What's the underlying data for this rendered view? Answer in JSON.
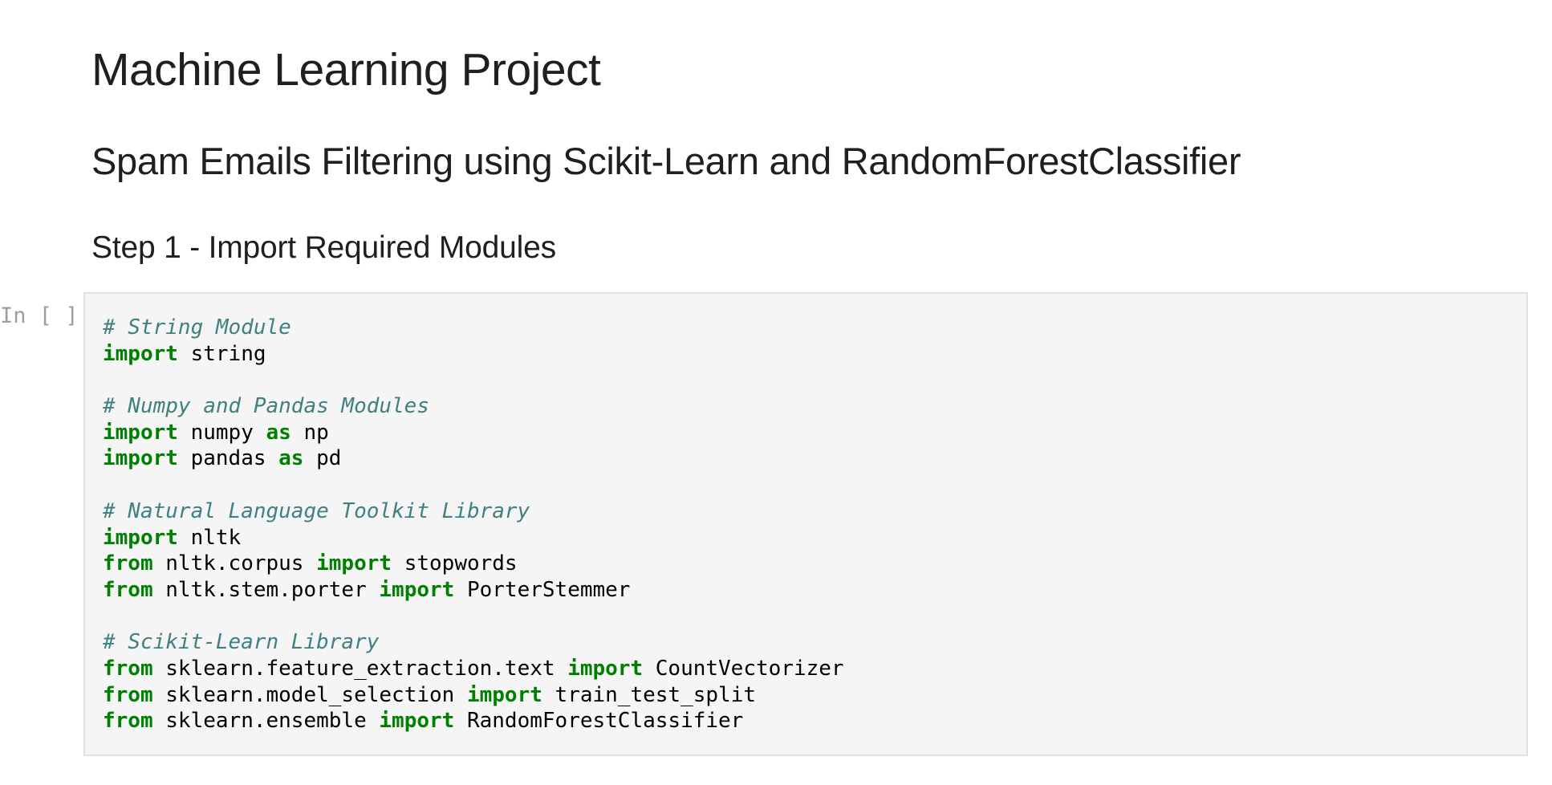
{
  "markdown": {
    "title": "Machine Learning Project",
    "subtitle": "Spam Emails Filtering using Scikit-Learn and RandomForestClassifier",
    "step_heading": "Step 1 - Import Required Modules"
  },
  "cell": {
    "prompt": "In [ ]:",
    "lines": [
      [
        {
          "t": "comment",
          "v": "# String Module"
        }
      ],
      [
        {
          "t": "keyword",
          "v": "import"
        },
        {
          "t": "plain",
          "v": " string"
        }
      ],
      [],
      [
        {
          "t": "comment",
          "v": "# Numpy and Pandas Modules"
        }
      ],
      [
        {
          "t": "keyword",
          "v": "import"
        },
        {
          "t": "plain",
          "v": " numpy "
        },
        {
          "t": "keyword",
          "v": "as"
        },
        {
          "t": "plain",
          "v": " np"
        }
      ],
      [
        {
          "t": "keyword",
          "v": "import"
        },
        {
          "t": "plain",
          "v": " pandas "
        },
        {
          "t": "keyword",
          "v": "as"
        },
        {
          "t": "plain",
          "v": " pd"
        }
      ],
      [],
      [
        {
          "t": "comment",
          "v": "# Natural Language Toolkit Library"
        }
      ],
      [
        {
          "t": "keyword",
          "v": "import"
        },
        {
          "t": "plain",
          "v": " nltk"
        }
      ],
      [
        {
          "t": "keyword",
          "v": "from"
        },
        {
          "t": "plain",
          "v": " nltk.corpus "
        },
        {
          "t": "keyword",
          "v": "import"
        },
        {
          "t": "plain",
          "v": " stopwords"
        }
      ],
      [
        {
          "t": "keyword",
          "v": "from"
        },
        {
          "t": "plain",
          "v": " nltk.stem.porter "
        },
        {
          "t": "keyword",
          "v": "import"
        },
        {
          "t": "plain",
          "v": " PorterStemmer"
        }
      ],
      [],
      [
        {
          "t": "comment",
          "v": "# Scikit-Learn Library"
        }
      ],
      [
        {
          "t": "keyword",
          "v": "from"
        },
        {
          "t": "plain",
          "v": " sklearn.feature_extraction.text "
        },
        {
          "t": "keyword",
          "v": "import"
        },
        {
          "t": "plain",
          "v": " CountVectorizer"
        }
      ],
      [
        {
          "t": "keyword",
          "v": "from"
        },
        {
          "t": "plain",
          "v": " sklearn.model_selection "
        },
        {
          "t": "keyword",
          "v": "import"
        },
        {
          "t": "plain",
          "v": " train_test_split"
        }
      ],
      [
        {
          "t": "keyword",
          "v": "from"
        },
        {
          "t": "plain",
          "v": " sklearn.ensemble "
        },
        {
          "t": "keyword",
          "v": "import"
        },
        {
          "t": "plain",
          "v": " RandomForestClassifier"
        }
      ]
    ]
  },
  "colors": {
    "comment": "#408080",
    "keyword": "#008000",
    "cell_background": "#f5f5f5",
    "cell_border": "#e0e0e0",
    "prompt": "#9e9e9e"
  }
}
